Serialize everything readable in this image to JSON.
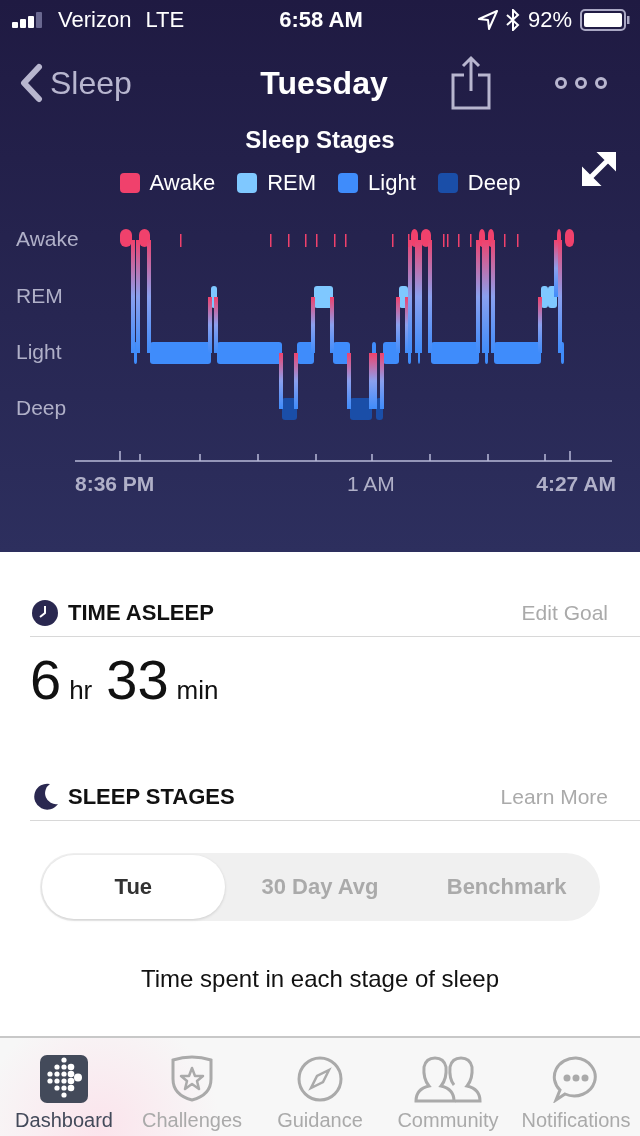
{
  "status_bar": {
    "carrier": "Verizon",
    "network": "LTE",
    "time": "6:58 AM",
    "battery": "92%"
  },
  "nav": {
    "back": "Sleep",
    "title": "Tuesday"
  },
  "chart": {
    "title": "Sleep Stages",
    "legend": [
      {
        "label": "Awake",
        "color": "#f0416c"
      },
      {
        "label": "REM",
        "color": "#7fc8ff"
      },
      {
        "label": "Light",
        "color": "#3f8cfb"
      },
      {
        "label": "Deep",
        "color": "#1a4ea8"
      }
    ],
    "stage_labels": [
      "Awake",
      "REM",
      "Light",
      "Deep"
    ],
    "time_labels": [
      "8:36 PM",
      "1 AM",
      "4:27 AM"
    ]
  },
  "time_asleep": {
    "heading": "TIME ASLEEP",
    "action": "Edit Goal",
    "hours": "6",
    "hours_unit": "hr",
    "minutes": "33",
    "minutes_unit": "min"
  },
  "sleep_stages": {
    "heading": "SLEEP STAGES",
    "action": "Learn More",
    "tabs": [
      {
        "label": "Tue",
        "selected": true
      },
      {
        "label": "30 Day Avg",
        "selected": false
      },
      {
        "label": "Benchmark",
        "selected": false
      }
    ],
    "caption": "Time spent in each stage of sleep"
  },
  "tab_bar": [
    {
      "label": "Dashboard",
      "kind": "dashboard",
      "selected": true
    },
    {
      "label": "Challenges",
      "kind": "challenges",
      "selected": false
    },
    {
      "label": "Guidance",
      "kind": "guidance",
      "selected": false
    },
    {
      "label": "Community",
      "kind": "community",
      "selected": false
    },
    {
      "label": "Notifications",
      "kind": "notifications",
      "selected": false
    }
  ]
}
